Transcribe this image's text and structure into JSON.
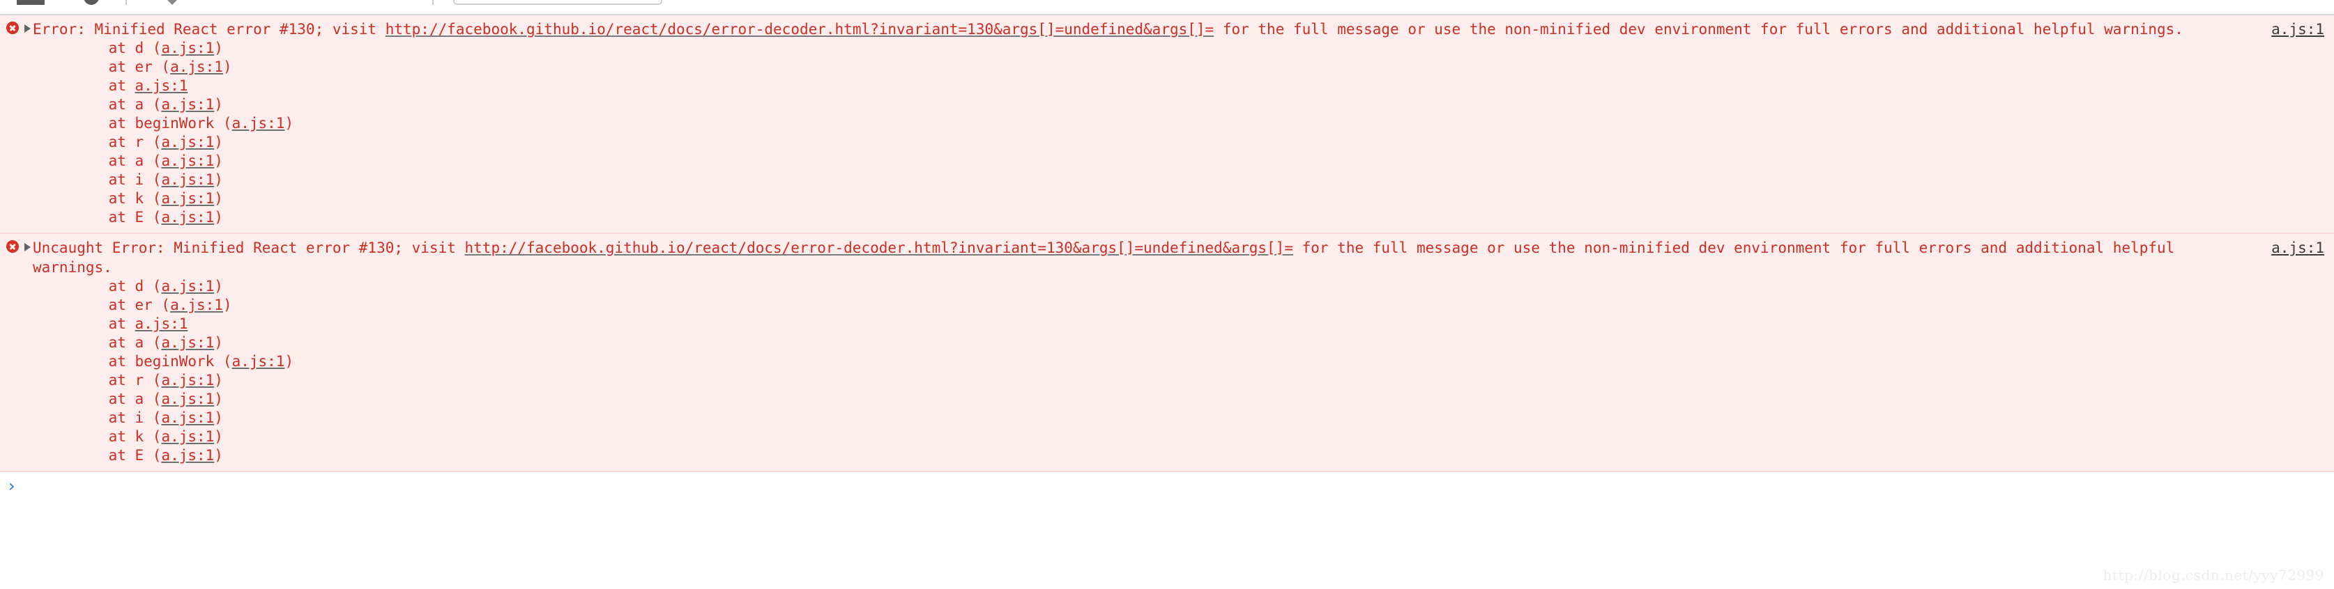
{
  "toolbar": {
    "icons": [
      "menu-bar-icon",
      "record-circle-icon",
      "divider",
      "caret-icon",
      "divider",
      "filter-box"
    ]
  },
  "console": {
    "messages": [
      {
        "level": "error",
        "icon": "error-circle-icon",
        "disclosure": "collapsed-triangle-icon",
        "text_before_link": "Error: Minified React error #130; visit ",
        "link": "http://facebook.github.io/react/docs/error-decoder.html?invariant=130&args[]=undefined&args[]=",
        "text_after_link": " for the full message or use the non-minified dev environment for full errors and additional helpful warnings.",
        "source": "a.js:1",
        "stack": [
          {
            "prefix": "    at d (",
            "link": "a.js:1",
            "suffix": ")"
          },
          {
            "prefix": "    at er (",
            "link": "a.js:1",
            "suffix": ")"
          },
          {
            "prefix": "    at ",
            "link": "a.js:1",
            "suffix": ""
          },
          {
            "prefix": "    at a (",
            "link": "a.js:1",
            "suffix": ")"
          },
          {
            "prefix": "    at beginWork (",
            "link": "a.js:1",
            "suffix": ")"
          },
          {
            "prefix": "    at r (",
            "link": "a.js:1",
            "suffix": ")"
          },
          {
            "prefix": "    at a (",
            "link": "a.js:1",
            "suffix": ")"
          },
          {
            "prefix": "    at i (",
            "link": "a.js:1",
            "suffix": ")"
          },
          {
            "prefix": "    at k (",
            "link": "a.js:1",
            "suffix": ")"
          },
          {
            "prefix": "    at E (",
            "link": "a.js:1",
            "suffix": ")"
          }
        ]
      },
      {
        "level": "error",
        "icon": "error-circle-icon",
        "disclosure": "collapsed-triangle-icon",
        "text_before_link": "Uncaught Error: Minified React error #130; visit ",
        "link": "http://facebook.github.io/react/docs/error-decoder.html?invariant=130&args[]=undefined&args[]=",
        "text_after_link": " for the full message or use the non-minified dev environment for full errors and additional helpful warnings.",
        "source": "a.js:1",
        "stack": [
          {
            "prefix": "    at d (",
            "link": "a.js:1",
            "suffix": ")"
          },
          {
            "prefix": "    at er (",
            "link": "a.js:1",
            "suffix": ")"
          },
          {
            "prefix": "    at ",
            "link": "a.js:1",
            "suffix": ""
          },
          {
            "prefix": "    at a (",
            "link": "a.js:1",
            "suffix": ")"
          },
          {
            "prefix": "    at beginWork (",
            "link": "a.js:1",
            "suffix": ")"
          },
          {
            "prefix": "    at r (",
            "link": "a.js:1",
            "suffix": ")"
          },
          {
            "prefix": "    at a (",
            "link": "a.js:1",
            "suffix": ")"
          },
          {
            "prefix": "    at i (",
            "link": "a.js:1",
            "suffix": ")"
          },
          {
            "prefix": "    at k (",
            "link": "a.js:1",
            "suffix": ")"
          },
          {
            "prefix": "    at E (",
            "link": "a.js:1",
            "suffix": ")"
          }
        ]
      }
    ]
  },
  "prompt": {
    "chevron": "›",
    "value": "",
    "placeholder": ""
  },
  "watermark": {
    "text": "http://blog.csdn.net/yyy72999"
  },
  "colors": {
    "error_bg": "#fdeded",
    "error_text": "#cc2f26",
    "error_icon": "#d93025",
    "divider": "#f7d6d6",
    "prompt": "#2a6fd6",
    "source_link": "#3b3b3b",
    "watermark": "#ededed"
  }
}
